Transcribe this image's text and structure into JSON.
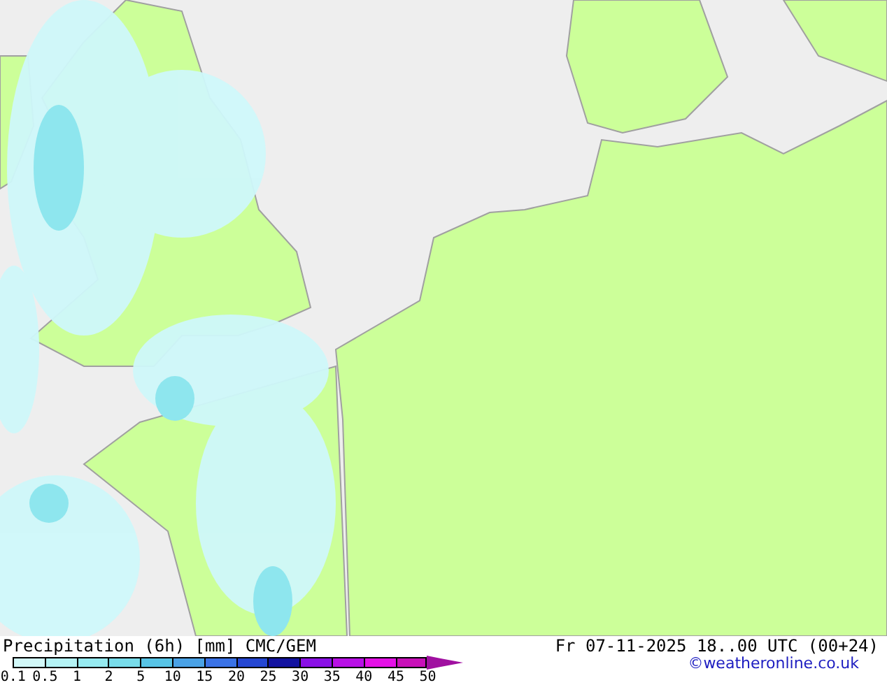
{
  "legend": {
    "title": "Precipitation (6h) [mm] CMC/GEM",
    "segments": [
      {
        "color": "#d2f8f8"
      },
      {
        "color": "#b4f2f4"
      },
      {
        "color": "#96eaf0"
      },
      {
        "color": "#78dcea"
      },
      {
        "color": "#58c4e6"
      },
      {
        "color": "#4aa2e6"
      },
      {
        "color": "#3a72e6"
      },
      {
        "color": "#2446d2"
      },
      {
        "color": "#1212a0"
      },
      {
        "color": "#8a10e6"
      },
      {
        "color": "#b810e6"
      },
      {
        "color": "#e410e6"
      },
      {
        "color": "#c810b8"
      }
    ],
    "labels": [
      "0.1",
      "0.5",
      "1",
      "2",
      "5",
      "10",
      "15",
      "20",
      "25",
      "30",
      "35",
      "40",
      "45",
      "50"
    ]
  },
  "valid_time": "Fr 07-11-2025 18..00 UTC (00+24)",
  "credit": "©weatheronline.co.uk"
}
